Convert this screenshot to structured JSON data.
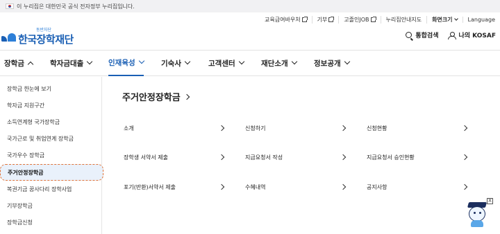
{
  "gov_banner": {
    "text": "이 누리집은 대한민국 공식 전자정부 누리집입니다."
  },
  "utility": [
    {
      "label": "교육급여바우처",
      "ext": true
    },
    {
      "label": "기부",
      "ext": true
    },
    {
      "label": "고졸인JOB",
      "ext": true
    },
    {
      "label": "누리집안내지도",
      "ext": false
    },
    {
      "label": "화면크기",
      "ext": false,
      "chevron": true
    },
    {
      "label": "Language",
      "ext": false
    }
  ],
  "logo": {
    "small": "동반자단",
    "big": "한국장학재단"
  },
  "search": {
    "label": "통합검색"
  },
  "mykosaf": {
    "label": "나의 KOSAF"
  },
  "gnb": [
    {
      "label": "장학금",
      "chev": "up"
    },
    {
      "label": "학자금대출",
      "chev": "down"
    },
    {
      "label": "인재육성",
      "chev": "down"
    },
    {
      "label": "기숙사",
      "chev": "down"
    },
    {
      "label": "고객센터",
      "chev": "down"
    },
    {
      "label": "재단소개",
      "chev": "down"
    },
    {
      "label": "정보공개",
      "chev": "down"
    }
  ],
  "sidebar": [
    {
      "label": "장학금 한눈에 보기"
    },
    {
      "label": "학자금 지원구간"
    },
    {
      "label": "소득연계형 국가장학금"
    },
    {
      "label": "국가근로 및 취업연계 장학금"
    },
    {
      "label": "국가우수 장학금"
    },
    {
      "label": "주거안정장학금"
    },
    {
      "label": "복권기금 꿈사다리 장학사업"
    },
    {
      "label": "기부장학금"
    },
    {
      "label": "장학금신청"
    }
  ],
  "page_title": "주거안정장학금",
  "cards": [
    {
      "label": "소개"
    },
    {
      "label": "신청하기"
    },
    {
      "label": "신청현황"
    },
    {
      "label": "장학생 서약서 제출"
    },
    {
      "label": "지급요청서 작성"
    },
    {
      "label": "지급요청서 승인현황"
    },
    {
      "label": "포기(반환)서약서 제출"
    },
    {
      "label": "수혜내역"
    },
    {
      "label": "공지사항"
    }
  ],
  "mascot": {
    "close": "X"
  },
  "colors": {
    "accent": "#1a5fb4",
    "active_bg": "#e9f1fb",
    "active_border": "#e0743a"
  }
}
